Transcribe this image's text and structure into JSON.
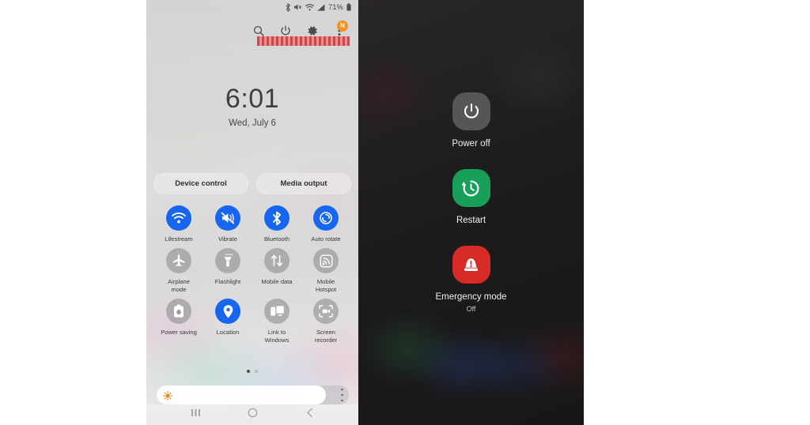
{
  "left_phone": {
    "status_bar": {
      "icons": [
        "bluetooth-icon",
        "mute-icon",
        "wifi-icon",
        "signal-icon"
      ],
      "battery_text": "71%",
      "battery_icon": "battery-icon"
    },
    "header": {
      "search_icon": "search-icon",
      "power_icon": "power-icon",
      "settings_icon": "gear-icon",
      "more_icon": "more-vertical-icon",
      "badge_text": "N",
      "redaction_label": ""
    },
    "clock": {
      "time": "6:01",
      "date": "Wed, July 6"
    },
    "pills": [
      {
        "label": "Device control",
        "name": "device-control-button"
      },
      {
        "label": "Media output",
        "name": "media-output-button"
      }
    ],
    "tiles": [
      [
        {
          "label": "Lifestream",
          "icon": "wifi-icon",
          "active": true
        },
        {
          "label": "Vibrate",
          "icon": "vibrate-icon",
          "active": true
        },
        {
          "label": "Bluetooth",
          "icon": "bluetooth-icon",
          "active": true
        },
        {
          "label": "Auto rotate",
          "icon": "auto-rotate-icon",
          "active": true
        }
      ],
      [
        {
          "label": "Airplane mode",
          "icon": "airplane-icon",
          "active": false
        },
        {
          "label": "Flashlight",
          "icon": "flashlight-icon",
          "active": false
        },
        {
          "label": "Mobile data",
          "icon": "mobile-data-icon",
          "active": false
        },
        {
          "label": "Mobile Hotspot",
          "icon": "hotspot-icon",
          "active": false
        }
      ],
      [
        {
          "label": "Power saving",
          "icon": "power-saving-icon",
          "active": false
        },
        {
          "label": "Location",
          "icon": "location-pin-icon",
          "active": true
        },
        {
          "label": "Link to Windows",
          "icon": "link-to-windows-icon",
          "active": false
        },
        {
          "label": "Screen recorder",
          "icon": "screen-recorder-icon",
          "active": false
        }
      ]
    ],
    "pagination": {
      "pages": 2,
      "active_page": 1
    },
    "brightness": {
      "icon": "brightness-sun-icon",
      "value_percent": 88,
      "menu_icon": "more-vertical-icon"
    },
    "nav_bar": {
      "recents_icon": "recents-icon",
      "home_icon": "home-icon",
      "back_icon": "back-icon"
    }
  },
  "right_phone": {
    "power_menu": [
      {
        "label": "Power off",
        "sub": "",
        "icon": "power-icon",
        "color": "#565659"
      },
      {
        "label": "Restart",
        "sub": "",
        "icon": "restart-icon",
        "color": "#18a05b"
      },
      {
        "label": "Emergency mode",
        "sub": "Off",
        "icon": "emergency-siren-icon",
        "color": "#d62b26"
      }
    ]
  },
  "colors": {
    "accent_blue": "#1666ef",
    "restart_green": "#18a05b",
    "emergency_red": "#d62b26",
    "badge_orange": "#f2870d",
    "redaction_red": "#f08080"
  }
}
